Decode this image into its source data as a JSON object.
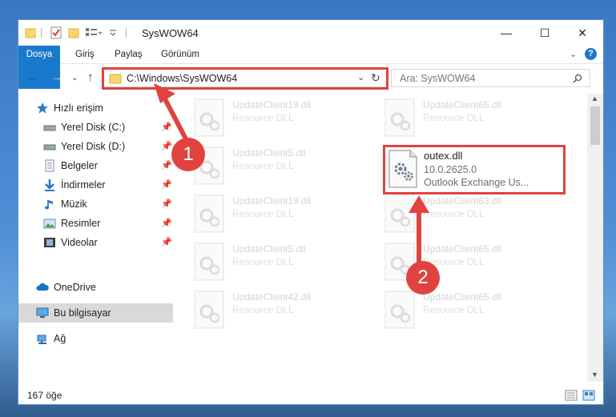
{
  "window": {
    "title": "SysWOW64",
    "minimize": "—",
    "maximize": "☐",
    "close": "✕"
  },
  "ribbon": {
    "tabs": [
      "Dosya",
      "Giriş",
      "Paylaş",
      "Görünüm"
    ],
    "help": "?"
  },
  "navigation": {
    "address": "C:\\Windows\\SysWOW64",
    "search_placeholder": "Ara: SysWOW64"
  },
  "sidebar": {
    "items": [
      {
        "label": "Hızlı erişim",
        "icon": "star-icon",
        "pinned": false
      },
      {
        "label": "Yerel Disk (C:)",
        "icon": "drive-icon",
        "pinned": true
      },
      {
        "label": "Yerel Disk (D:)",
        "icon": "drive-icon",
        "pinned": true
      },
      {
        "label": "Belgeler",
        "icon": "document-icon",
        "pinned": true
      },
      {
        "label": "İndirmeler",
        "icon": "download-icon",
        "pinned": true
      },
      {
        "label": "Müzik",
        "icon": "music-icon",
        "pinned": true
      },
      {
        "label": "Resimler",
        "icon": "pictures-icon",
        "pinned": true
      },
      {
        "label": "Videolar",
        "icon": "video-icon",
        "pinned": true
      },
      {
        "label": "OneDrive",
        "icon": "cloud-icon",
        "pinned": false
      },
      {
        "label": "Bu bilgisayar",
        "icon": "computer-icon",
        "pinned": false,
        "selected": true
      },
      {
        "label": "Ağ",
        "icon": "network-icon",
        "pinned": false
      }
    ]
  },
  "files": {
    "left": [
      {
        "name": "UpdateClient19.dll",
        "desc": "Resource DLL"
      },
      {
        "name": "UpdateClient5.dll",
        "desc": "Resource DLL"
      },
      {
        "name": "UpdateClient19.dll",
        "desc": "Resource DLL"
      },
      {
        "name": "UpdateClient5.dll",
        "desc": "Resource DLL"
      },
      {
        "name": "UpdateClient42.dll",
        "desc": "Resource DLL"
      }
    ],
    "right": [
      {
        "name": "UpdateClient65.dll",
        "desc": "Resource DLL"
      },
      {
        "name": "UpdateClient63.dll",
        "desc": "Resource DLL"
      },
      {
        "name": "UpdateClient65.dll",
        "desc": "Resource DLL"
      },
      {
        "name": "UpdateClient65.dll",
        "desc": "Resource DLL"
      }
    ],
    "featured": {
      "name": "outex.dll",
      "version": "10.0.2625.0",
      "desc": "Outlook Exchange Us..."
    }
  },
  "status": {
    "count": "167 öğe"
  },
  "annotations": {
    "step1": "1",
    "step2": "2",
    "color": "#e0433f"
  }
}
